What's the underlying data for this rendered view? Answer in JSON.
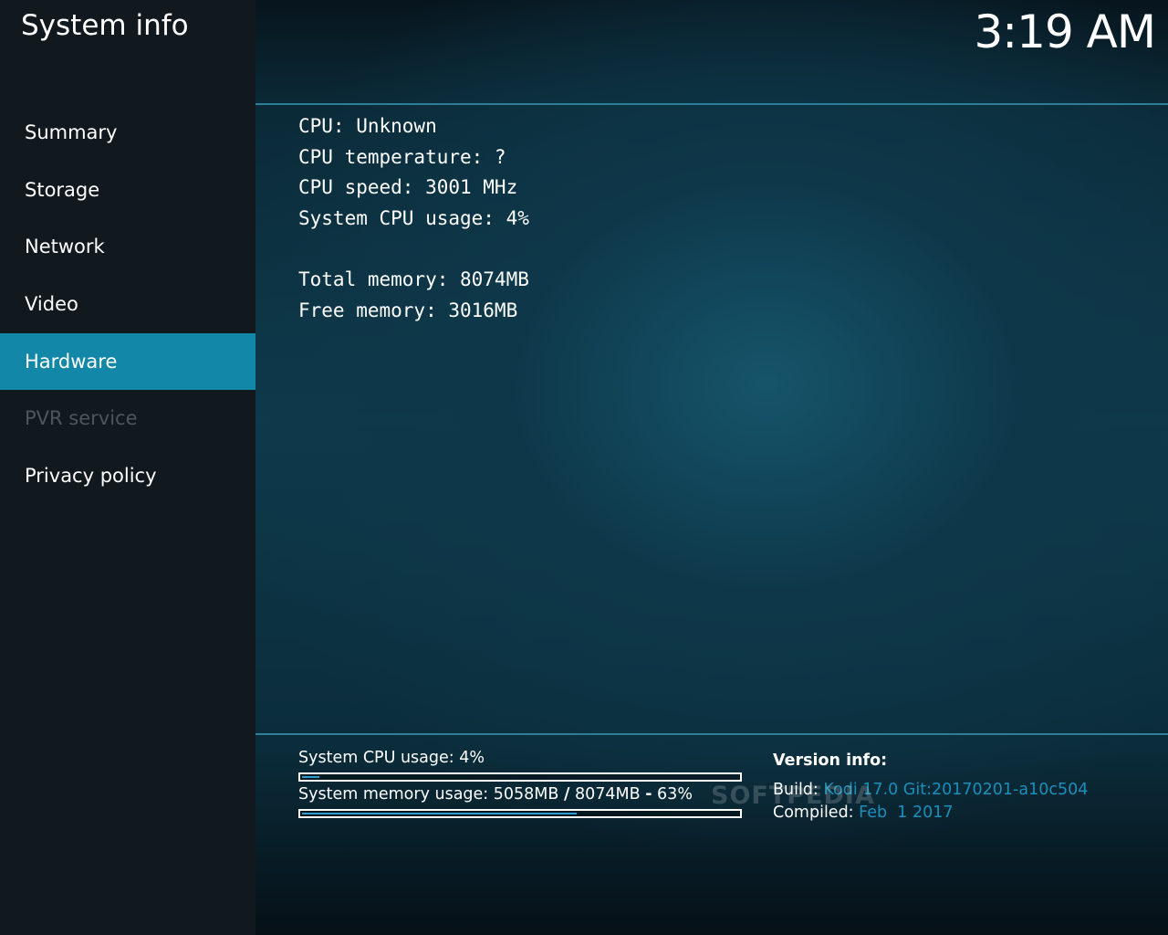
{
  "window": {
    "title": "System info",
    "clock": "3:19 AM"
  },
  "sidebar": {
    "items": [
      {
        "label": "Summary",
        "state": "normal"
      },
      {
        "label": "Storage",
        "state": "normal"
      },
      {
        "label": "Network",
        "state": "normal"
      },
      {
        "label": "Video",
        "state": "normal"
      },
      {
        "label": "Hardware",
        "state": "selected"
      },
      {
        "label": "PVR service",
        "state": "disabled"
      },
      {
        "label": "Privacy policy",
        "state": "normal"
      }
    ]
  },
  "hardware": {
    "cpu": "CPU: Unknown",
    "cpu_temperature": "CPU temperature: ?",
    "cpu_speed": "CPU speed: 3001 MHz",
    "cpu_usage": "System CPU usage: 4%",
    "total_memory": "Total memory: 8074MB",
    "free_memory": "Free memory: 3016MB"
  },
  "footer": {
    "cpu_usage_label": "System CPU usage: 4%",
    "cpu_usage_fraction": 0.04,
    "memory_usage_prefix": "System memory usage: 5058MB",
    "memory_usage_slash": "/",
    "memory_usage_middle": "8074MB",
    "memory_usage_dash": "-",
    "memory_usage_percent": "63%",
    "memory_usage_fraction": 0.63,
    "version_title": "Version info:",
    "build_label": "Build:",
    "build_value": "Kodi 17.0 Git:20170201-a10c504",
    "compiled_label": "Compiled:",
    "compiled_value": "Feb  1 2017"
  },
  "watermark": "SOFTPEDIA",
  "colors": {
    "accent": "#1287a8",
    "progress": "#2a9ed0",
    "link_value": "#1a8fbc",
    "disabled": "#4b565e"
  }
}
